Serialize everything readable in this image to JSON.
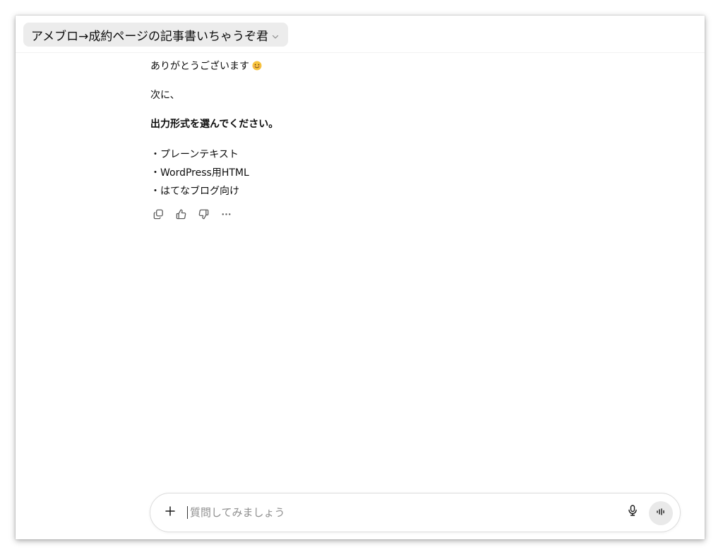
{
  "header": {
    "title": "アメブロ→成約ページの記事書いちゃうぞ君"
  },
  "message": {
    "greeting": "ありがとうございます",
    "next": "次に、",
    "instruction": "出力形式を選んでください。",
    "options": [
      "・プレーンテキスト",
      "・WordPress用HTML",
      "・はてなブログ向け"
    ]
  },
  "actions": [
    "copy-icon",
    "thumbs-up-icon",
    "thumbs-down-icon",
    "more-icon"
  ],
  "composer": {
    "placeholder": "質問してみましょう",
    "value": ""
  },
  "colors": {
    "title_bg": "#ececec",
    "text": "#0d0d0d",
    "placeholder": "#8f8f8f",
    "voice_bg": "#e9e9e9"
  }
}
